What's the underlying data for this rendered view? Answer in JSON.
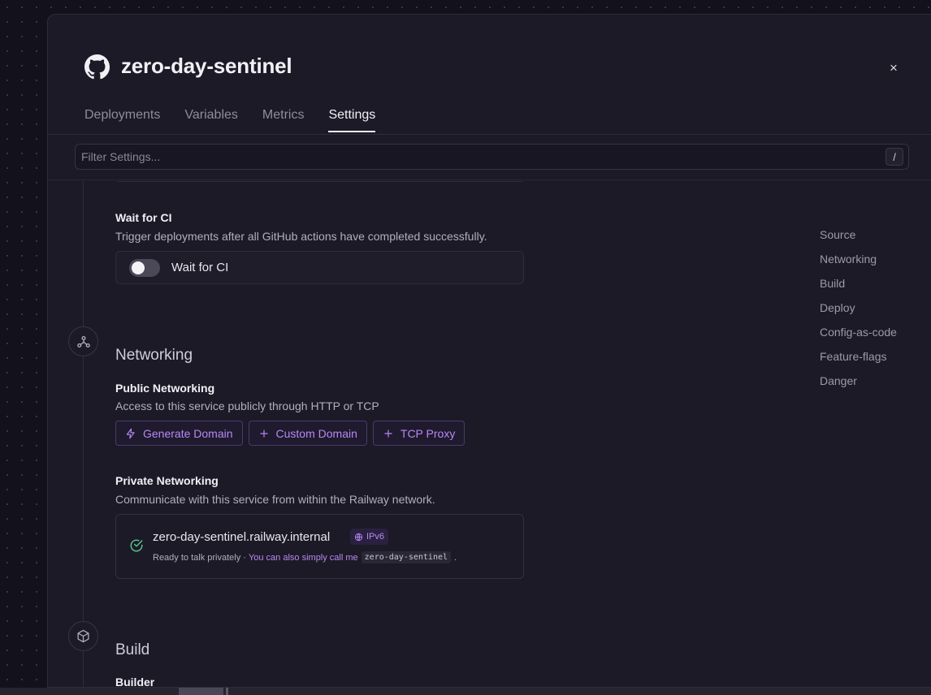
{
  "header": {
    "title": "zero-day-sentinel",
    "close_label": "×"
  },
  "tabs": [
    {
      "label": "Deployments",
      "active": false
    },
    {
      "label": "Variables",
      "active": false
    },
    {
      "label": "Metrics",
      "active": false
    },
    {
      "label": "Settings",
      "active": true
    }
  ],
  "filter": {
    "placeholder": "Filter Settings...",
    "shortcut": "/"
  },
  "wait_for_ci": {
    "label": "Wait for CI",
    "description": "Trigger deployments after all GitHub actions have completed successfully.",
    "toggle_label": "Wait for CI",
    "enabled": false
  },
  "networking": {
    "title": "Networking",
    "public": {
      "label": "Public Networking",
      "description": "Access to this service publicly through HTTP or TCP",
      "buttons": [
        "Generate Domain",
        "Custom Domain",
        "TCP Proxy"
      ]
    },
    "private": {
      "label": "Private Networking",
      "description": "Communicate with this service from within the Railway network.",
      "domain": "zero-day-sentinel.railway.internal",
      "badge": "IPv6",
      "status": "Ready to talk privately ·",
      "hint": "You can also simply call me",
      "alias": "zero-day-sentinel",
      "hint_end": "."
    }
  },
  "build": {
    "title": "Build",
    "builder_label": "Builder"
  },
  "sidenav": [
    "Source",
    "Networking",
    "Build",
    "Deploy",
    "Config-as-code",
    "Feature-flags",
    "Danger"
  ],
  "colors": {
    "accent": "#b889f2",
    "panel_bg": "#1c1a26",
    "page_bg": "#13111c"
  }
}
